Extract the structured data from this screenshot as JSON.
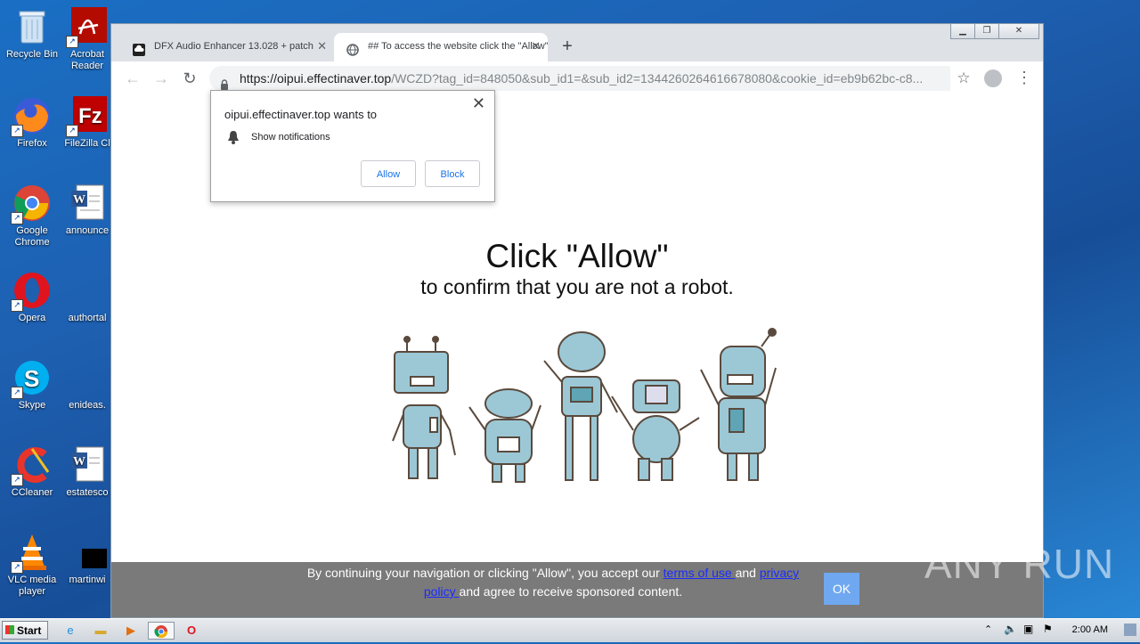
{
  "desktop": {
    "icons": [
      {
        "label": "Recycle Bin"
      },
      {
        "label": "Acrobat Reader"
      },
      {
        "label": "Firefox"
      },
      {
        "label": "FileZilla Cl"
      },
      {
        "label": "Google Chrome"
      },
      {
        "label": "announce"
      },
      {
        "label": "Opera"
      },
      {
        "label": "authortal"
      },
      {
        "label": "Skype"
      },
      {
        "label": "enideas."
      },
      {
        "label": "CCleaner"
      },
      {
        "label": "estatesco"
      },
      {
        "label": "VLC media player"
      },
      {
        "label": "martinwi"
      }
    ]
  },
  "browser": {
    "tabs": [
      {
        "title": "DFX Audio Enhancer 13.028 + patch",
        "active": false
      },
      {
        "title": "## To access the website click the \"Allow\"",
        "active": true
      }
    ],
    "url_host": "https://oipui.effectinaver.top",
    "url_path": "/WCZD?tag_id=848050&sub_id1=&sub_id2=1344260264616678080&cookie_id=eb9b62bc-c8..."
  },
  "permission_popup": {
    "title": "oipui.effectinaver.top wants to",
    "permission": "Show notifications",
    "allow_label": "Allow",
    "block_label": "Block"
  },
  "page": {
    "headline": "Click \"Allow\"",
    "subline": "to confirm that you are not a robot."
  },
  "cookie_bar": {
    "text_before": "By continuing your navigation or clicking \"Allow\", you accept our ",
    "terms_link": "terms of use ",
    "text_and": "and ",
    "privacy_link": "privacy policy ",
    "text_after": "and agree to receive sponsored content.",
    "ok_label": "OK"
  },
  "watermark": "ANY RUN",
  "taskbar": {
    "start_label": "Start",
    "clock": "2:00 AM"
  }
}
